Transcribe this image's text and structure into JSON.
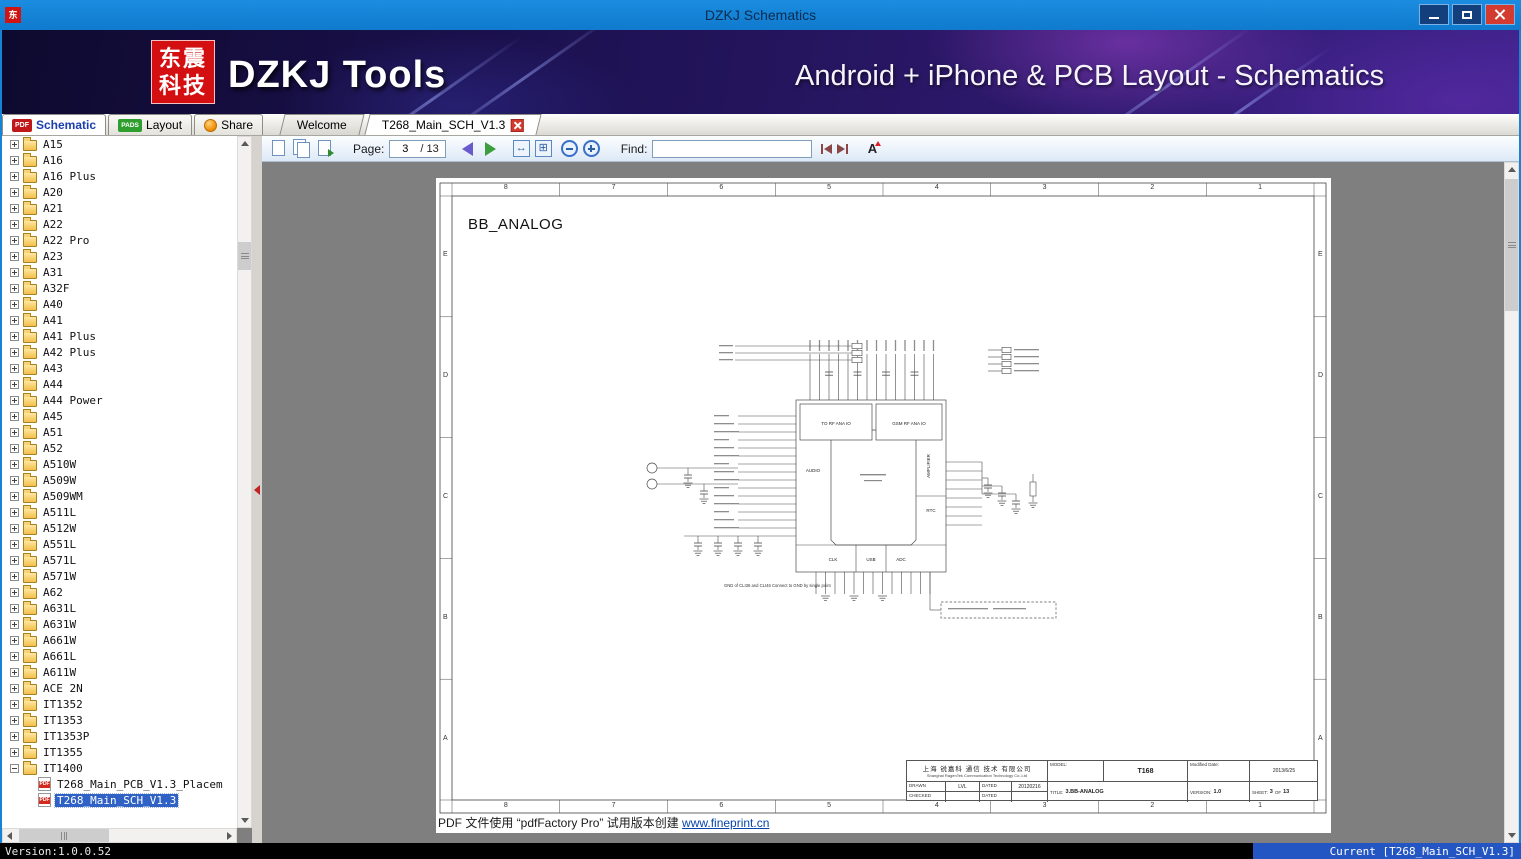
{
  "window": {
    "title": "DZKJ Schematics",
    "app_icon_text": "东",
    "status_version": "Version:1.0.0.52",
    "status_current": "Current [T268_Main_SCH_V1.3]"
  },
  "banner": {
    "logo_line1": "东震",
    "logo_line2": "科技",
    "app_name": "DZKJ Tools",
    "tagline": "Android + iPhone & PCB Layout - Schematics"
  },
  "icons": {
    "pdf_badge": "PDF",
    "pads_badge": "PADS",
    "fit_width_glyph": "↔",
    "fit_page_glyph": "⊞",
    "font_glyph": "A"
  },
  "tabs": {
    "schematic_label": "Schematic",
    "layout_label": "Layout",
    "share_label": "Share",
    "welcome_label": "Welcome",
    "document_label": "T268_Main_SCH_V1.3"
  },
  "toolbar": {
    "page_label": "Page:",
    "page_value": "3",
    "page_total": "/ 13",
    "find_label": "Find:",
    "find_value": ""
  },
  "sidebar": {
    "folders": [
      "A15",
      "A16",
      "A16 Plus",
      "A20",
      "A21",
      "A22",
      "A22 Pro",
      "A23",
      "A31",
      "A32F",
      "A40",
      "A41",
      "A41 Plus",
      "A42 Plus",
      "A43",
      "A44",
      "A44 Power",
      "A45",
      "A51",
      "A52",
      "A510W",
      "A509W",
      "A509WM",
      "A511L",
      "A512W",
      "A551L",
      "A571L",
      "A571W",
      "A62",
      "A631L",
      "A631W",
      "A661W",
      "A661L",
      "A611W",
      "ACE 2N",
      "IT1352",
      "IT1353",
      "IT1353P",
      "IT1355",
      "IT1400"
    ],
    "expanded": "IT1400",
    "children": [
      {
        "label": "T268_Main_PCB_V1.3_Placem",
        "selected": false
      },
      {
        "label": "T268_Main_SCH_V1.3",
        "selected": true
      }
    ]
  },
  "schematic": {
    "sheet_title": "BB_ANALOG",
    "grid_cols": [
      "8",
      "7",
      "6",
      "5",
      "4",
      "3",
      "2",
      "1"
    ],
    "grid_rows": [
      "E",
      "D",
      "C",
      "B",
      "A"
    ],
    "blocks": {
      "rf_tx": "TO RF ANA IO",
      "rf_gsm": "GSM RF ANA IO",
      "audio": "AUDIO",
      "amplifier": "AMPLIFIER",
      "rtc": "RTC",
      "clk": "CLK",
      "usb": "USB",
      "adc": "ADC"
    },
    "note": "GND of CLI36 and CLI46 Connect to GND by single point",
    "titleblock": {
      "company_cn": "上海 锐嘉科 通信 技术 有限公司",
      "company_en": "Shanghai RagenTek Communication Technology Co.,Ltd",
      "model_label": "MODEL:",
      "model": "T168",
      "modified_label": "Modified Date:",
      "modified_date": "2013/6/25",
      "drawn_label": "DRAWN",
      "drawn": "LVL",
      "dated_label": "DATED",
      "drawn_date": "20120216",
      "checked_label": "CHECKED",
      "title_label": "TITLE:",
      "title": "3.BB-ANALOG",
      "version_label": "VERSION:",
      "version": "1.0",
      "sheet_label": "SHEET:",
      "sheet": "3",
      "of_label": "OF",
      "sheet_total": "13"
    },
    "pdf_stamp": "PDF 文件使用 “pdfFactory Pro” 试用版本创建 ",
    "pdf_link": "www.fineprint.cn"
  }
}
